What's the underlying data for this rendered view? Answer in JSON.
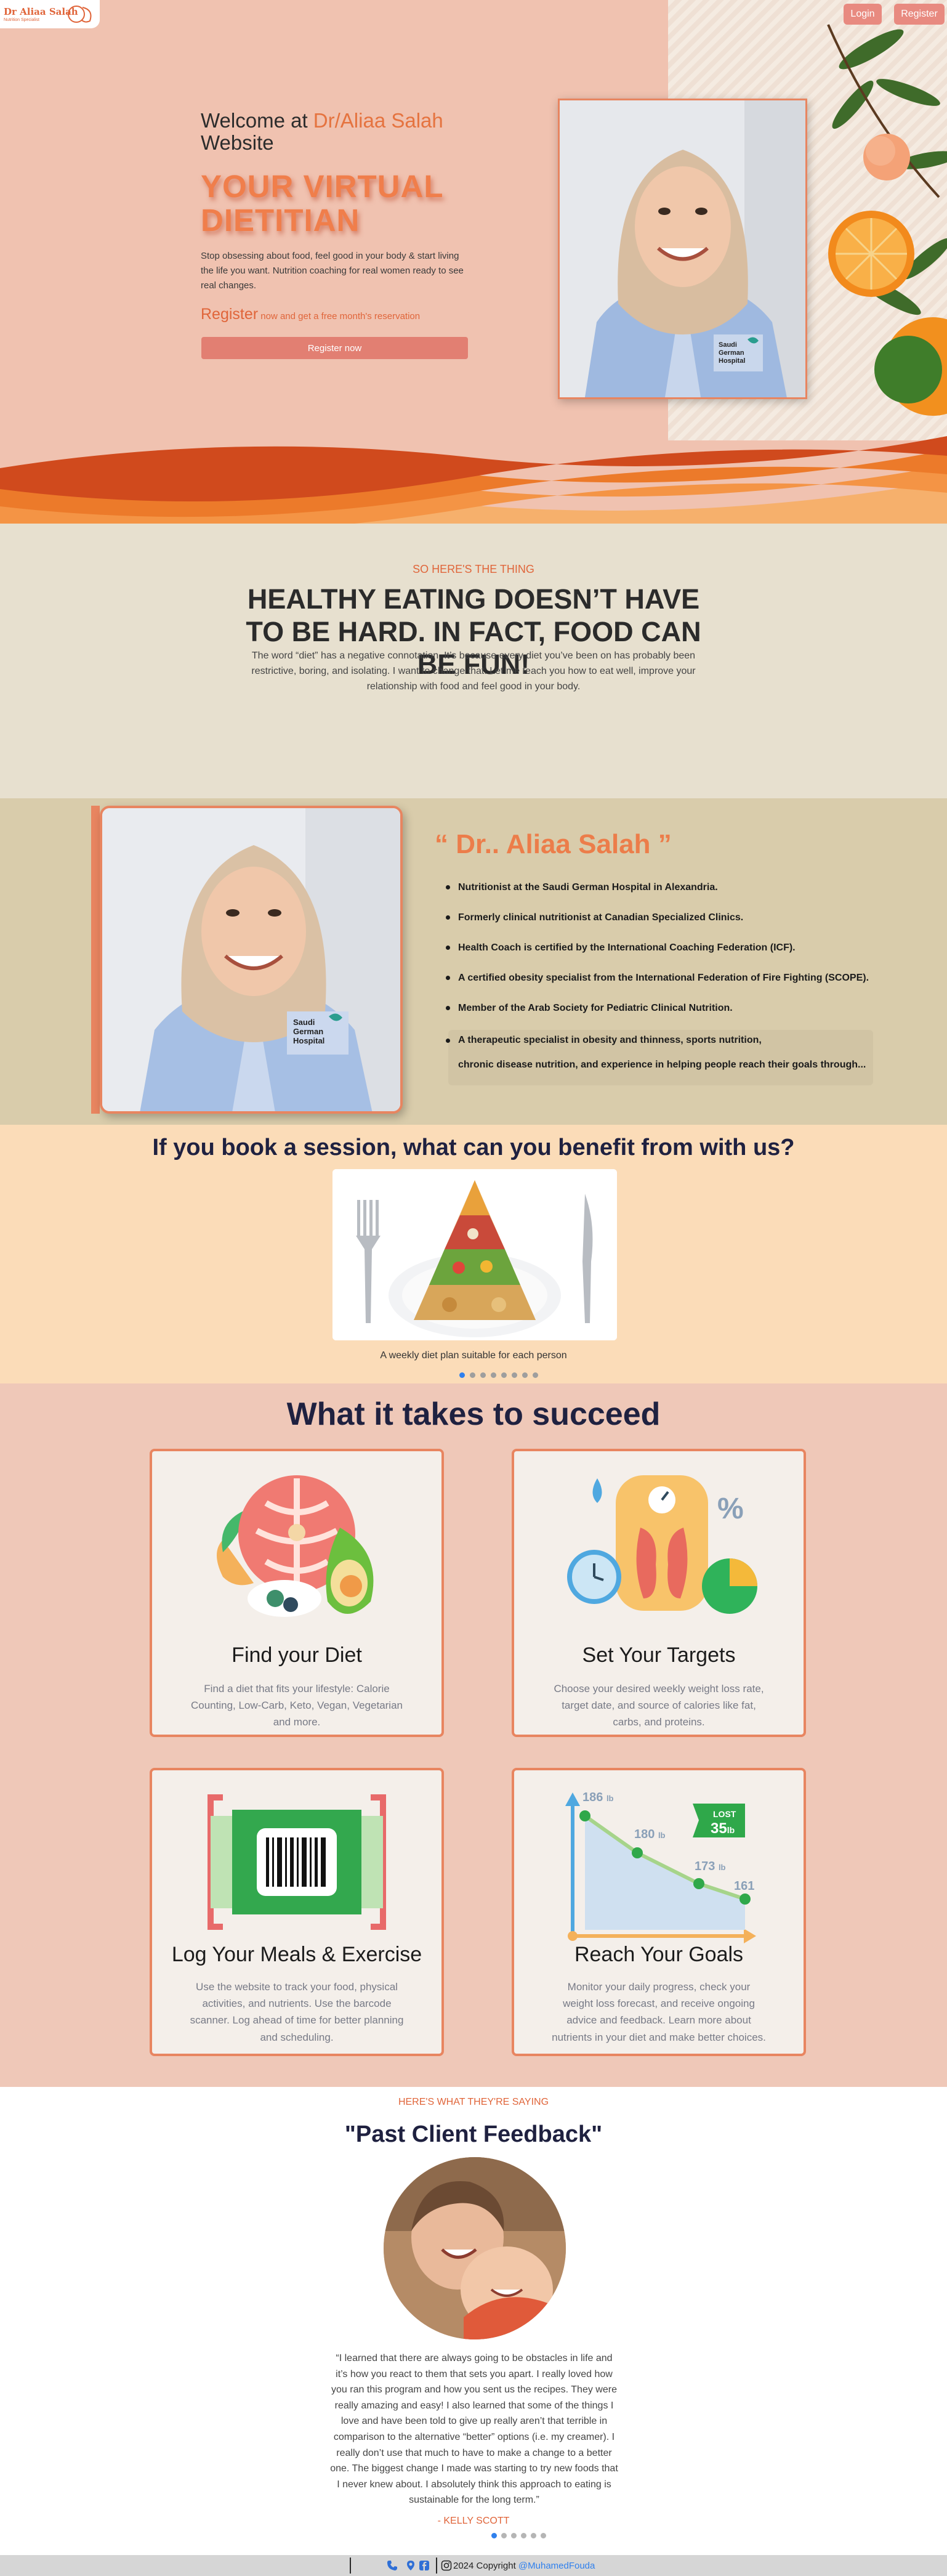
{
  "nav": {
    "logo_text": "Dr Aliaa Salah",
    "logo_sub": "Nutrition Specialist",
    "login": "Login",
    "register": "Register"
  },
  "hero": {
    "welcome_prefix": "Welcome at ",
    "welcome_name": "Dr/Aliaa Salah",
    "welcome_suffix": "Website",
    "title_line1": "YOUR VIRTUAL",
    "title_line2": "DIETITIAN",
    "description": "Stop obsessing about food, feel good in your body & start living the life you want. Nutrition coaching for real women ready to see real changes.",
    "register_big": "Register",
    "register_small": " now and get a free month's reservation",
    "button": "Register now"
  },
  "thing": {
    "kicker": "SO HERE'S THE THING",
    "title": "HEALTHY EATING DOESN’T HAVE TO BE HARD. IN FACT, FOOD CAN BE FUN!",
    "text": "The word “diet” has a negative connotation. It’s because every diet you’ve been on has probably been restrictive, boring, and isolating. I want to change that. Let me teach you how to eat well, improve your relationship with food and feel good in your body."
  },
  "about": {
    "name": "“ Dr.. Aliaa Salah ”",
    "items": [
      "Nutritionist at the Saudi German Hospital in Alexandria.",
      "Formerly clinical nutritionist at Canadian Specialized Clinics.",
      "Health Coach is certified by the International Coaching Federation (ICF).",
      "A certified obesity specialist from the International Federation of Fire Fighting (SCOPE).",
      "Member of the Arab Society for Pediatric Clinical Nutrition."
    ],
    "last_line1": "A therapeutic specialist in obesity and thinness, sports nutrition,",
    "last_line2": "chronic disease nutrition, and experience in helping people reach their goals through..."
  },
  "benefits": {
    "title": "If you book a session, what can you benefit from with us?",
    "caption": "A weekly diet plan suitable for each person",
    "slide_count": 8,
    "active_slide": 0
  },
  "succeed": {
    "title": "What it takes to succeed",
    "cards": [
      {
        "title": "Find your Diet",
        "text": "Find a diet that fits your lifestyle: Calorie Counting, Low-Carb, Keto, Vegan, Vegetarian and more."
      },
      {
        "title": "Set Your Targets",
        "text": "Choose your desired weekly weight loss rate, target date, and source of calories like fat, carbs, and proteins."
      },
      {
        "title": "Log Your Meals & Exercise",
        "text": "Use the website to track your food, physical activities, and nutrients. Use the barcode scanner. Log ahead of time for better planning and scheduling."
      },
      {
        "title": "Reach Your Goals",
        "text": "Monitor your daily progress, check your weight loss forecast, and receive ongoing advice and feedback. Learn more about nutrients in your diet and make better choices."
      }
    ],
    "goals_art": {
      "w1": "186",
      "w2": "180",
      "w3": "173",
      "w4": "161",
      "unit": "lb",
      "lost_label": "LOST",
      "lost_value": "35"
    }
  },
  "testimonial": {
    "kicker": "HERE'S WHAT THEY'RE SAYING",
    "title": "\"Past Client Feedback\"",
    "quote": "“I learned that there are always going to be obstacles in life and it’s how you react to them that sets you apart. I really loved how you ran this program and how you sent us the recipes. They were really amazing and easy! I also learned that some of the things I love and have been told to give up really aren’t that terrible in comparison to the alternative “better” options (i.e. my creamer). I really don’t use that much to have to make a change to a better one. The biggest change I made was starting to try new foods that I never knew about. I absolutely think this approach to eating is sustainable for the long term.”",
    "author": "- KELLY SCOTT",
    "slide_count": 6,
    "active_slide": 0
  },
  "footer": {
    "copy": "2024 Copyright ",
    "author": "@MuhamedFouda",
    "icons": [
      "location-icon",
      "phone-icon",
      "facebook-icon",
      "instagram-icon"
    ]
  },
  "colors": {
    "accent": "#e5733f",
    "hero_bg": "#f0c2b0",
    "button": "#e27f72",
    "navy": "#1f2140"
  }
}
